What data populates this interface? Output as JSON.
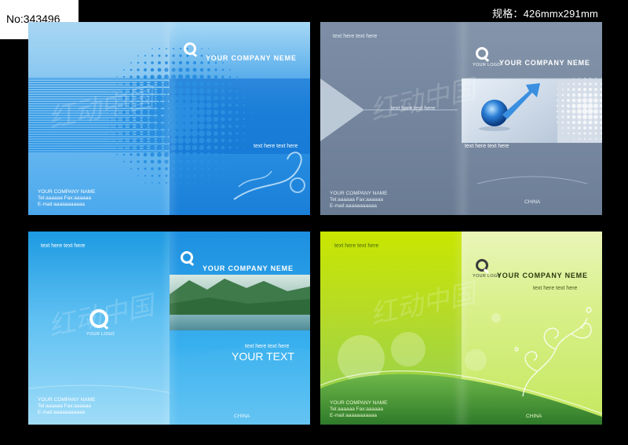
{
  "badge": {
    "id_text": "No:343496"
  },
  "spec": {
    "text": "规格：426mmx291mm"
  },
  "watermark": {
    "text": "红动中国"
  },
  "panels": {
    "blue_dots": {
      "company": "YOUR COMPANY NEME",
      "band_text": "text here text here",
      "contact": [
        "YOUR COMPANY NAME",
        "Tel:aaaaaa Fax:aaaaaa",
        "E-mail:aaaaaaaaaaa"
      ]
    },
    "gray_globe": {
      "left_top": "text here text here",
      "arrow_text": "text here text here",
      "logo_cap": "YOUR LOGO",
      "company": "YOUR COMPANY NEME",
      "photo_caption": "text here text here",
      "contact": [
        "YOUR COMPANY NAME",
        "Tel:aaaaaa Fax:aaaaaa",
        "E-mail:aaaaaaaaaaa"
      ],
      "country": "CHINA"
    },
    "blue_landscape": {
      "left_top": "text here text here",
      "logo_cap": "YOUR LOGO",
      "company": "YOUR COMPANY NEME",
      "sub_text": "text here text here",
      "big_text": "YOUR TEXT",
      "contact": [
        "YOUR COMPANY NAME",
        "Tel:aaaaaa Fax:aaaaaa",
        "E-mail:aaaaaaaaaaa"
      ],
      "country": "CHINA"
    },
    "green_circles": {
      "left_top": "text here text here",
      "logo_cap": "YOUR LOGO",
      "company": "YOUR COMPANY NEME",
      "sub_text": "text here text here",
      "contact": [
        "YOUR COMPANY NAME",
        "Tel:aaaaaa Fax:aaaaaa",
        "E-mail:aaaaaaaaaaa"
      ],
      "country": "CHINA"
    }
  }
}
